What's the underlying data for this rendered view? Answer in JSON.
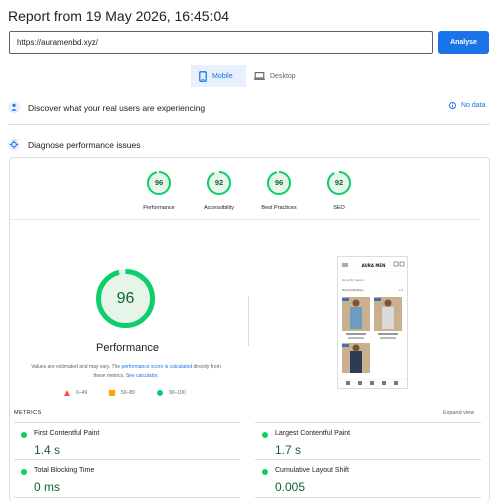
{
  "report": {
    "title": "Report from 19 May 2026, 16:45:04"
  },
  "url_bar": {
    "value": "https://auramenbd.xyz/",
    "analyze_label": "Analyse"
  },
  "device_tabs": [
    {
      "label": "Mobile",
      "active": true
    },
    {
      "label": "Desktop",
      "active": false
    }
  ],
  "field_data": {
    "title": "Discover what your real users are experiencing",
    "no_data_label": "No data"
  },
  "diagnose": {
    "title": "Diagnose performance issues"
  },
  "scores": [
    {
      "label": "Performance",
      "value": 96
    },
    {
      "label": "Accessibility",
      "value": 92
    },
    {
      "label": "Best Practices",
      "value": 96
    },
    {
      "label": "SEO",
      "value": 92
    }
  ],
  "performance": {
    "score": 96,
    "label": "Performance",
    "note_prefix": "Values are estimated and may vary. The ",
    "note_link": "performance score is calculated",
    "note_middle": " directly from these metrics. ",
    "note_link2": "See calculator",
    "note_suffix": "."
  },
  "legend": [
    {
      "range": "0–49",
      "color": "#ff4e42"
    },
    {
      "range": "50–89",
      "color": "#ffa400"
    },
    {
      "range": "90–100",
      "color": "#0cce6b"
    }
  ],
  "screenshot": {
    "brand": "AURA MEN",
    "section": "Recently Viewed",
    "sort": "Shop Collections",
    "sale_badge": "Sale"
  },
  "metrics": {
    "heading": "METRICS",
    "expand_label": "Expand view",
    "items": [
      {
        "name": "First Contentful Paint",
        "value": "1.4 s",
        "status_color": "#0cce6b"
      },
      {
        "name": "Largest Contentful Paint",
        "value": "1.7 s",
        "status_color": "#0cce6b"
      },
      {
        "name": "Total Blocking Time",
        "value": "0 ms",
        "status_color": "#0cce6b"
      },
      {
        "name": "Cumulative Layout Shift",
        "value": "0.005",
        "status_color": "#0cce6b"
      }
    ]
  },
  "colors": {
    "accent": "#1a73e8",
    "pass": "#0cce6b",
    "pass_text": "#0d652d",
    "pass_fill": "#e6f4ea"
  }
}
